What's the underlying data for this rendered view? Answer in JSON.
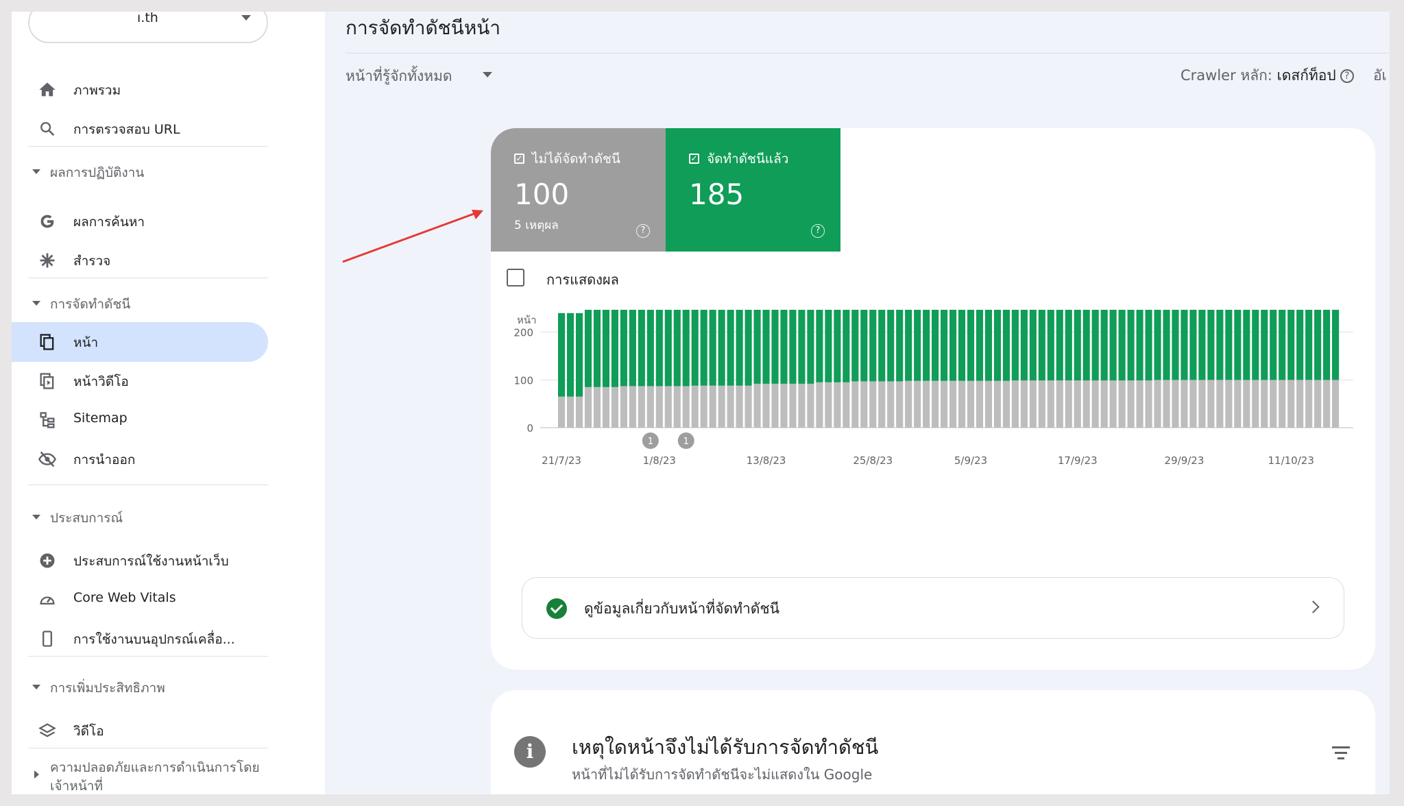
{
  "sidebar": {
    "property": "ı.th",
    "items": [
      {
        "label": "ภาพรวม",
        "icon": "home-icon"
      },
      {
        "label": "การตรวจสอบ URL",
        "icon": "search-icon"
      }
    ],
    "sections": [
      {
        "label": "ผลการปฏิบัติงาน"
      },
      {
        "label": "การจัดทำดัชนี"
      },
      {
        "label": "ประสบการณ์"
      },
      {
        "label": "การเพิ่มประสิทธิภาพ"
      },
      {
        "label": "ความปลอดภัยและการดำเนินการโดยเจ้าหน้าที่"
      }
    ],
    "performance_items": [
      {
        "label": "ผลการค้นหา",
        "icon": "google-g-icon"
      },
      {
        "label": "สำรวจ",
        "icon": "asterisk-icon"
      }
    ],
    "indexing_items": [
      {
        "label": "หน้า",
        "icon": "pages-icon",
        "active": true
      },
      {
        "label": "หน้าวิดีโอ",
        "icon": "video-page-icon"
      },
      {
        "label": "Sitemap",
        "icon": "sitemap-icon"
      },
      {
        "label": "การนำออก",
        "icon": "eye-off-icon"
      }
    ],
    "experience_items": [
      {
        "label": "ประสบการณ์ใช้งานหน้าเว็บ",
        "icon": "plus-circle-icon"
      },
      {
        "label": "Core Web Vitals",
        "icon": "gauge-icon"
      },
      {
        "label": "การใช้งานบนอุปกรณ์เคลื่อ...",
        "icon": "mobile-icon"
      }
    ],
    "enhancement_items": [
      {
        "label": "วิดีโอ",
        "icon": "layers-icon"
      }
    ]
  },
  "header": {
    "title": "การจัดทำดัชนีหน้า",
    "filter": "หน้าที่รู้จักทั้งหมด",
    "crawler_label": "Crawler หลัก:",
    "crawler_value": "เดสก์ท็อป",
    "cut_text": "อัเ"
  },
  "tiles": {
    "not_indexed": {
      "label": "ไม่ได้จัดทำดัชนี",
      "value": "100",
      "sub": "5 เหตุผล",
      "color": "#9e9e9e"
    },
    "indexed": {
      "label": "จัดทำดัชนีแล้ว",
      "value": "185",
      "color": "#0f9d58"
    }
  },
  "impressions_label": "การแสดงผล",
  "chart_data": {
    "type": "bar",
    "stacked": true,
    "ylabel": "หน้า",
    "ylim": [
      0,
      300
    ],
    "yticks": [
      0,
      100,
      200,
      300
    ],
    "xtick_labels": [
      "21/7/23",
      "1/8/23",
      "13/8/23",
      "25/8/23",
      "5/9/23",
      "17/9/23",
      "29/9/23",
      "11/10/23"
    ],
    "xtick_bar_index": [
      0,
      11,
      23,
      35,
      46,
      58,
      70,
      82
    ],
    "annotations": [
      {
        "bar_index": 10,
        "label": "1"
      },
      {
        "bar_index": 14,
        "label": "1"
      }
    ],
    "series": [
      {
        "name": "ไม่ได้จัดทำดัชนี",
        "color": "#bdbdbd",
        "values": [
          65,
          65,
          65,
          85,
          85,
          85,
          85,
          87,
          87,
          87,
          87,
          87,
          87,
          87,
          87,
          88,
          88,
          88,
          88,
          88,
          88,
          88,
          92,
          92,
          92,
          92,
          92,
          92,
          92,
          95,
          95,
          95,
          95,
          97,
          97,
          97,
          97,
          97,
          97,
          98,
          98,
          98,
          98,
          98,
          98,
          98,
          98,
          98,
          98,
          98,
          98,
          99,
          99,
          99,
          99,
          99,
          99,
          99,
          99,
          99,
          99,
          99,
          99,
          99,
          99,
          99,
          99,
          100,
          100,
          100,
          100,
          100,
          100,
          100,
          100,
          100,
          100,
          100,
          100,
          100,
          100,
          100,
          100,
          100,
          100,
          100,
          100,
          100
        ]
      },
      {
        "name": "จัดทำดัชนีแล้ว",
        "color": "#0f9d58",
        "values": [
          175,
          175,
          175,
          173,
          173,
          173,
          173,
          173,
          173,
          173,
          173,
          173,
          173,
          173,
          173,
          173,
          173,
          173,
          173,
          173,
          173,
          173,
          170,
          170,
          170,
          170,
          170,
          170,
          170,
          171,
          171,
          171,
          171,
          173,
          173,
          173,
          173,
          173,
          173,
          176,
          176,
          176,
          176,
          176,
          176,
          176,
          176,
          176,
          176,
          178,
          178,
          179,
          179,
          179,
          179,
          179,
          179,
          179,
          179,
          181,
          181,
          181,
          181,
          181,
          181,
          181,
          181,
          182,
          182,
          182,
          182,
          182,
          182,
          182,
          182,
          182,
          182,
          182,
          182,
          182,
          182,
          183,
          183,
          183,
          184,
          184,
          184,
          185
        ]
      }
    ]
  },
  "info_row": {
    "label": "ดูข้อมูลเกี่ยวกับหน้าที่จัดทำดัชนี"
  },
  "reasons_card": {
    "title": "เหตุใดหน้าจึงไม่ได้รับการจัดทำดัชนี",
    "subtitle": "หน้าที่ไม่ได้รับการจัดทำดัชนีจะไม่แสดงใน Google"
  }
}
